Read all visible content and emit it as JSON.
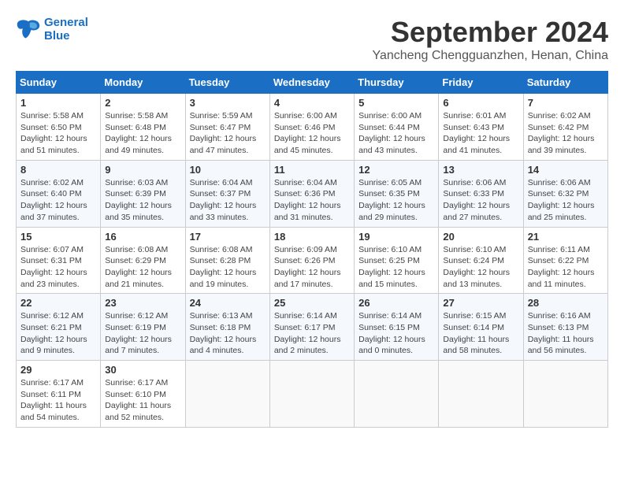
{
  "logo": {
    "line1": "General",
    "line2": "Blue"
  },
  "title": "September 2024",
  "location": "Yancheng Chengguanzhen, Henan, China",
  "days_of_week": [
    "Sunday",
    "Monday",
    "Tuesday",
    "Wednesday",
    "Thursday",
    "Friday",
    "Saturday"
  ],
  "weeks": [
    [
      {
        "day": "1",
        "info": "Sunrise: 5:58 AM\nSunset: 6:50 PM\nDaylight: 12 hours\nand 51 minutes."
      },
      {
        "day": "2",
        "info": "Sunrise: 5:58 AM\nSunset: 6:48 PM\nDaylight: 12 hours\nand 49 minutes."
      },
      {
        "day": "3",
        "info": "Sunrise: 5:59 AM\nSunset: 6:47 PM\nDaylight: 12 hours\nand 47 minutes."
      },
      {
        "day": "4",
        "info": "Sunrise: 6:00 AM\nSunset: 6:46 PM\nDaylight: 12 hours\nand 45 minutes."
      },
      {
        "day": "5",
        "info": "Sunrise: 6:00 AM\nSunset: 6:44 PM\nDaylight: 12 hours\nand 43 minutes."
      },
      {
        "day": "6",
        "info": "Sunrise: 6:01 AM\nSunset: 6:43 PM\nDaylight: 12 hours\nand 41 minutes."
      },
      {
        "day": "7",
        "info": "Sunrise: 6:02 AM\nSunset: 6:42 PM\nDaylight: 12 hours\nand 39 minutes."
      }
    ],
    [
      {
        "day": "8",
        "info": "Sunrise: 6:02 AM\nSunset: 6:40 PM\nDaylight: 12 hours\nand 37 minutes."
      },
      {
        "day": "9",
        "info": "Sunrise: 6:03 AM\nSunset: 6:39 PM\nDaylight: 12 hours\nand 35 minutes."
      },
      {
        "day": "10",
        "info": "Sunrise: 6:04 AM\nSunset: 6:37 PM\nDaylight: 12 hours\nand 33 minutes."
      },
      {
        "day": "11",
        "info": "Sunrise: 6:04 AM\nSunset: 6:36 PM\nDaylight: 12 hours\nand 31 minutes."
      },
      {
        "day": "12",
        "info": "Sunrise: 6:05 AM\nSunset: 6:35 PM\nDaylight: 12 hours\nand 29 minutes."
      },
      {
        "day": "13",
        "info": "Sunrise: 6:06 AM\nSunset: 6:33 PM\nDaylight: 12 hours\nand 27 minutes."
      },
      {
        "day": "14",
        "info": "Sunrise: 6:06 AM\nSunset: 6:32 PM\nDaylight: 12 hours\nand 25 minutes."
      }
    ],
    [
      {
        "day": "15",
        "info": "Sunrise: 6:07 AM\nSunset: 6:31 PM\nDaylight: 12 hours\nand 23 minutes."
      },
      {
        "day": "16",
        "info": "Sunrise: 6:08 AM\nSunset: 6:29 PM\nDaylight: 12 hours\nand 21 minutes."
      },
      {
        "day": "17",
        "info": "Sunrise: 6:08 AM\nSunset: 6:28 PM\nDaylight: 12 hours\nand 19 minutes."
      },
      {
        "day": "18",
        "info": "Sunrise: 6:09 AM\nSunset: 6:26 PM\nDaylight: 12 hours\nand 17 minutes."
      },
      {
        "day": "19",
        "info": "Sunrise: 6:10 AM\nSunset: 6:25 PM\nDaylight: 12 hours\nand 15 minutes."
      },
      {
        "day": "20",
        "info": "Sunrise: 6:10 AM\nSunset: 6:24 PM\nDaylight: 12 hours\nand 13 minutes."
      },
      {
        "day": "21",
        "info": "Sunrise: 6:11 AM\nSunset: 6:22 PM\nDaylight: 12 hours\nand 11 minutes."
      }
    ],
    [
      {
        "day": "22",
        "info": "Sunrise: 6:12 AM\nSunset: 6:21 PM\nDaylight: 12 hours\nand 9 minutes."
      },
      {
        "day": "23",
        "info": "Sunrise: 6:12 AM\nSunset: 6:19 PM\nDaylight: 12 hours\nand 7 minutes."
      },
      {
        "day": "24",
        "info": "Sunrise: 6:13 AM\nSunset: 6:18 PM\nDaylight: 12 hours\nand 4 minutes."
      },
      {
        "day": "25",
        "info": "Sunrise: 6:14 AM\nSunset: 6:17 PM\nDaylight: 12 hours\nand 2 minutes."
      },
      {
        "day": "26",
        "info": "Sunrise: 6:14 AM\nSunset: 6:15 PM\nDaylight: 12 hours\nand 0 minutes."
      },
      {
        "day": "27",
        "info": "Sunrise: 6:15 AM\nSunset: 6:14 PM\nDaylight: 11 hours\nand 58 minutes."
      },
      {
        "day": "28",
        "info": "Sunrise: 6:16 AM\nSunset: 6:13 PM\nDaylight: 11 hours\nand 56 minutes."
      }
    ],
    [
      {
        "day": "29",
        "info": "Sunrise: 6:17 AM\nSunset: 6:11 PM\nDaylight: 11 hours\nand 54 minutes."
      },
      {
        "day": "30",
        "info": "Sunrise: 6:17 AM\nSunset: 6:10 PM\nDaylight: 11 hours\nand 52 minutes."
      },
      {
        "day": "",
        "info": ""
      },
      {
        "day": "",
        "info": ""
      },
      {
        "day": "",
        "info": ""
      },
      {
        "day": "",
        "info": ""
      },
      {
        "day": "",
        "info": ""
      }
    ]
  ]
}
